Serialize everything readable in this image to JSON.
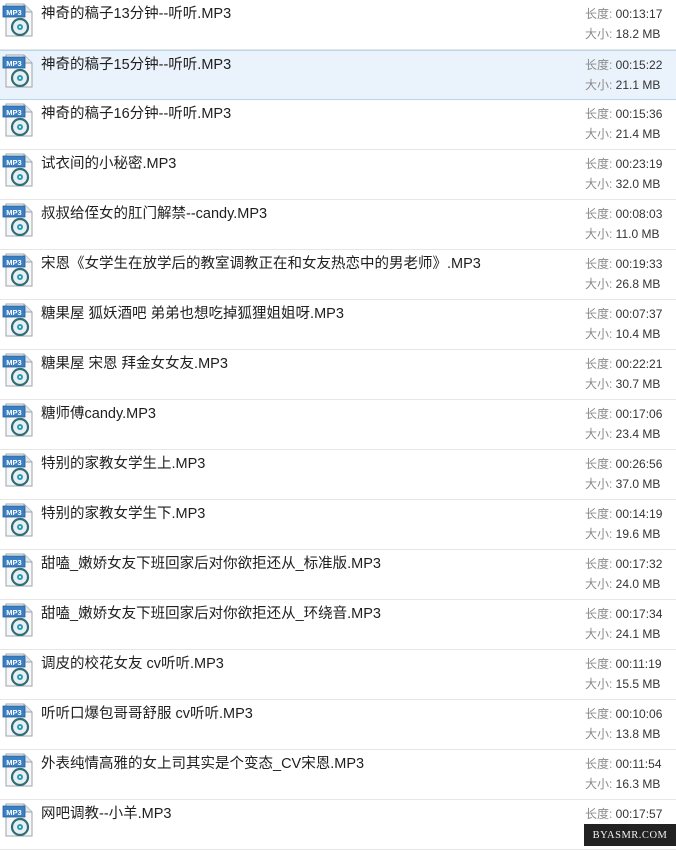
{
  "labels": {
    "length": "长度: ",
    "size": "大小: "
  },
  "icon": {
    "badge_text": "MP3",
    "name": "mp3-file-icon"
  },
  "files": [
    {
      "name": "神奇的稿子13分钟--听听.MP3",
      "length": "00:13:17",
      "size": "18.2 MB"
    },
    {
      "name": "神奇的稿子15分钟--听听.MP3",
      "length": "00:15:22",
      "size": "21.1 MB",
      "selected": true
    },
    {
      "name": "神奇的稿子16分钟--听听.MP3",
      "length": "00:15:36",
      "size": "21.4 MB"
    },
    {
      "name": "试衣间的小秘密.MP3",
      "length": "00:23:19",
      "size": "32.0 MB"
    },
    {
      "name": "叔叔给侄女的肛门解禁--candy.MP3",
      "length": "00:08:03",
      "size": "11.0 MB"
    },
    {
      "name": "宋恩《女学生在放学后的教室调教正在和女友热恋中的男老师》.MP3",
      "length": "00:19:33",
      "size": "26.8 MB"
    },
    {
      "name": "糖果屋 狐妖酒吧 弟弟也想吃掉狐狸姐姐呀.MP3",
      "length": "00:07:37",
      "size": "10.4 MB"
    },
    {
      "name": "糖果屋 宋恩 拜金女女友.MP3",
      "length": "00:22:21",
      "size": "30.7 MB"
    },
    {
      "name": "糖师傅candy.MP3",
      "length": "00:17:06",
      "size": "23.4 MB"
    },
    {
      "name": "特别的家教女学生上.MP3",
      "length": "00:26:56",
      "size": "37.0 MB"
    },
    {
      "name": "特别的家教女学生下.MP3",
      "length": "00:14:19",
      "size": "19.6 MB"
    },
    {
      "name": "甜嗑_嫩娇女友下班回家后对你欲拒还从_标准版.MP3",
      "length": "00:17:32",
      "size": "24.0 MB"
    },
    {
      "name": "甜嗑_嫩娇女友下班回家后对你欲拒还从_环绕音.MP3",
      "length": "00:17:34",
      "size": "24.1 MB"
    },
    {
      "name": "调皮的校花女友 cv听听.MP3",
      "length": "00:11:19",
      "size": "15.5 MB"
    },
    {
      "name": "听听口爆包哥哥舒服 cv听听.MP3",
      "length": "00:10:06",
      "size": "13.8 MB"
    },
    {
      "name": "外表纯情高雅的女上司其实是个变态_CV宋恩.MP3",
      "length": "00:11:54",
      "size": "16.3 MB"
    },
    {
      "name": "网吧调教--小羊.MP3",
      "length": "00:17:57",
      "size": ""
    }
  ],
  "watermark": "BYASMR.COM"
}
